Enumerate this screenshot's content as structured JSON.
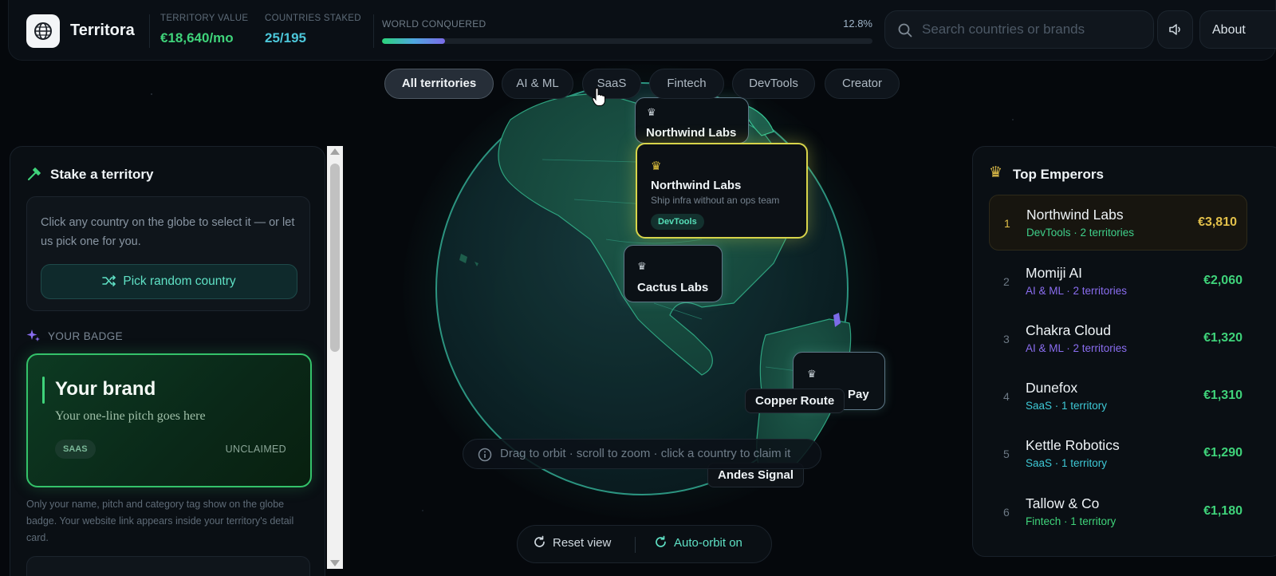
{
  "app": {
    "name": "Territora"
  },
  "stats": {
    "territory_value_label": "TERRITORY VALUE",
    "territory_value": "€18,640/mo",
    "countries_staked_label": "COUNTRIES STAKED",
    "countries_staked": "25/195",
    "world_conquered_label": "WORLD CONQUERED",
    "world_conquered_pct": "12.8%",
    "world_conquered_fraction": 0.128
  },
  "search": {
    "placeholder": "Search countries or brands"
  },
  "header": {
    "about_label": "About"
  },
  "filters": [
    {
      "label": "All territories",
      "active": true
    },
    {
      "label": "AI & ML",
      "active": false
    },
    {
      "label": "SaaS",
      "active": false
    },
    {
      "label": "Fintech",
      "active": false
    },
    {
      "label": "DevTools",
      "active": false
    },
    {
      "label": "Creator",
      "active": false
    }
  ],
  "globe": {
    "cards": [
      {
        "name": "Northwind Labs"
      },
      {
        "name": "Northwind Labs",
        "pitch": "Ship infra without an ops team",
        "tag": "DevTools",
        "highlighted": true
      },
      {
        "name": "Cactus Labs"
      },
      {
        "name": "Pay"
      }
    ],
    "labels": [
      "Copper Route",
      "Andes Signal"
    ],
    "hint": "Drag to orbit · scroll to zoom · click a country to claim it",
    "reset_label": "Reset view",
    "auto_orbit_label": "Auto-orbit on"
  },
  "stake": {
    "title": "Stake a territory",
    "instructions": "Click any country on the globe to select it — or let us pick one for you.",
    "random_button": "Pick random country",
    "badge_section_label": "YOUR BADGE",
    "badge": {
      "title": "Your brand",
      "pitch": "Your one-line pitch goes here",
      "tag": "SAAS",
      "status": "UNCLAIMED"
    },
    "badge_note": "Only your name, pitch and category tag show on the globe badge. Your website link appears inside your territory's detail card."
  },
  "emperors": {
    "title": "Top Emperors",
    "list": [
      {
        "rank": "1",
        "name": "Northwind Labs",
        "meta": "DevTools · 2 territories",
        "value": "€3,810",
        "meta_color": "#3fcf8a",
        "value_color": "#e2c04a"
      },
      {
        "rank": "2",
        "name": "Momiji AI",
        "meta": "AI & ML · 2 territories",
        "value": "€2,060",
        "meta_color": "#8a6df0",
        "value_color": "#3fd37a"
      },
      {
        "rank": "3",
        "name": "Chakra Cloud",
        "meta": "AI & ML · 2 territories",
        "value": "€1,320",
        "meta_color": "#8a6df0",
        "value_color": "#3fd37a"
      },
      {
        "rank": "4",
        "name": "Dunefox",
        "meta": "SaaS · 1 territory",
        "value": "€1,310",
        "meta_color": "#3ec9d6",
        "value_color": "#3fd37a"
      },
      {
        "rank": "5",
        "name": "Kettle Robotics",
        "meta": "SaaS · 1 territory",
        "value": "€1,290",
        "meta_color": "#3ec9d6",
        "value_color": "#3fd37a"
      },
      {
        "rank": "6",
        "name": "Tallow & Co",
        "meta": "Fintech · 1 territory",
        "value": "€1,180",
        "meta_color": "#3fd37a",
        "value_color": "#3fd37a"
      }
    ]
  },
  "colors": {
    "accent_green": "#3fd37a",
    "accent_teal": "#5fe1c5",
    "gold": "#d8d44a"
  }
}
